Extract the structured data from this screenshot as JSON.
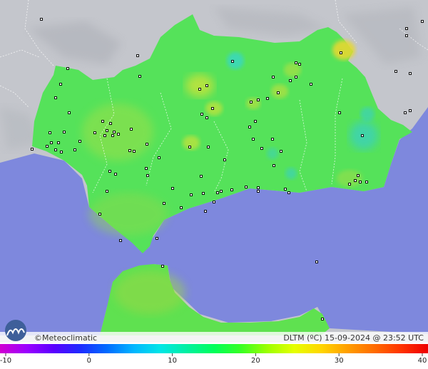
{
  "map": {
    "brand": "Meteoclimatic",
    "copyright_symbol": "©",
    "caption": "DLTM (ºC) 15-09-2024 @ 23:52 UTC",
    "colors": {
      "sea": "#7e88dd",
      "land_other": "#c4c6cc",
      "land_main": "#55e25a",
      "border_line": "#ffffff",
      "station_dot": "#ffffff"
    },
    "legend": {
      "ticks": [
        "-10",
        "0",
        "10",
        "20",
        "30",
        "40"
      ],
      "range": [
        -10,
        40
      ],
      "colors": [
        "#d100d1",
        "#9b00ff",
        "#5b00ff",
        "#1e2bff",
        "#006bff",
        "#00b6ff",
        "#00e6e6",
        "#00f0a0",
        "#00ff5a",
        "#37ff24",
        "#9dff00",
        "#e6ff00",
        "#ffd600",
        "#ff9e00",
        "#ff6b00",
        "#ff3300",
        "#ee0000"
      ]
    }
  }
}
